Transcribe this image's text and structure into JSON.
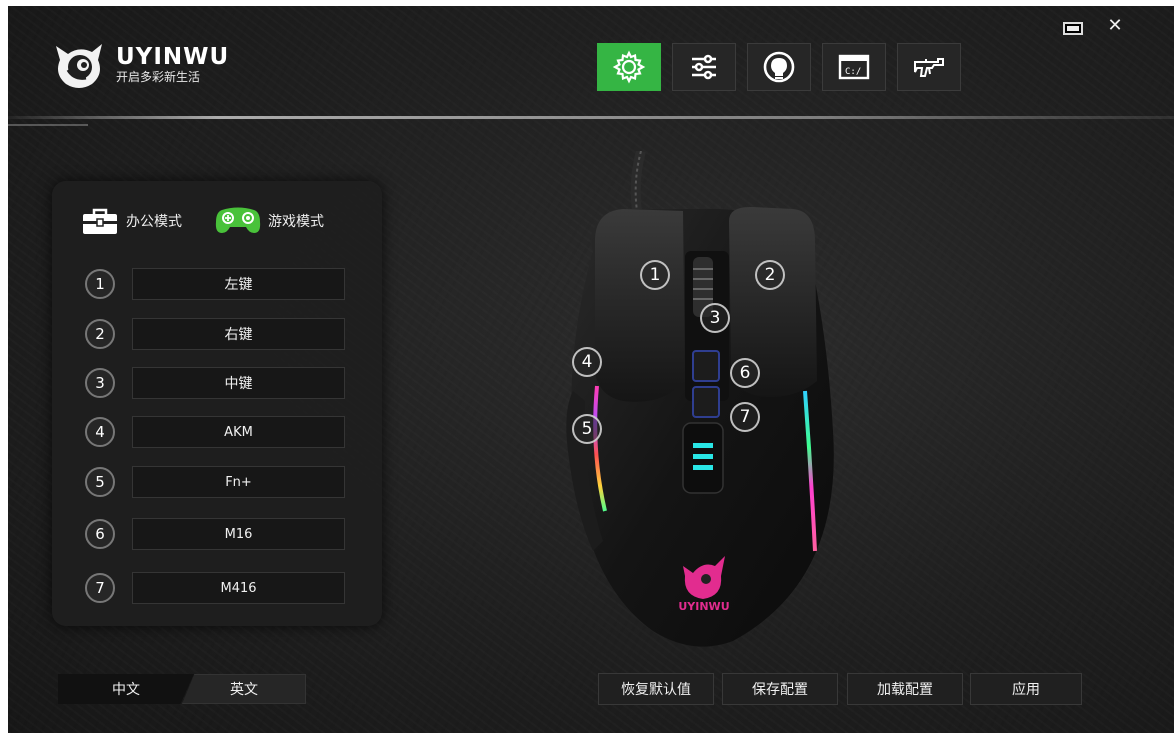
{
  "app": {
    "brand_name": "UYINWU",
    "brand_slogan": "开启多彩新生活",
    "window_controls": {
      "minimize": "minimize-icon",
      "close": "✕"
    }
  },
  "toolbar": {
    "tabs": [
      {
        "icon": "gear-icon",
        "active": true
      },
      {
        "icon": "sliders-icon",
        "active": false
      },
      {
        "icon": "lightbulb-icon",
        "active": false
      },
      {
        "icon": "console-icon",
        "active": false
      },
      {
        "icon": "rifle-icon",
        "active": false
      }
    ],
    "active_color": "#35b544"
  },
  "modes": {
    "office_label": "办公模式",
    "game_label": "游戏模式"
  },
  "buttons": [
    {
      "num": "1",
      "value": "左键"
    },
    {
      "num": "2",
      "value": "右键"
    },
    {
      "num": "3",
      "value": "中键"
    },
    {
      "num": "4",
      "value": "AKM"
    },
    {
      "num": "5",
      "value": "Fn+"
    },
    {
      "num": "6",
      "value": "M16"
    },
    {
      "num": "7",
      "value": "M416"
    }
  ],
  "mouse": {
    "logo_text": "UYINWU",
    "callouts": [
      "1",
      "2",
      "3",
      "4",
      "5",
      "6",
      "7"
    ]
  },
  "language": {
    "chinese": "中文",
    "english": "英文",
    "selected": "中文"
  },
  "actions": {
    "reset": "恢复默认值",
    "save": "保存配置",
    "load": "加载配置",
    "apply": "应用"
  }
}
